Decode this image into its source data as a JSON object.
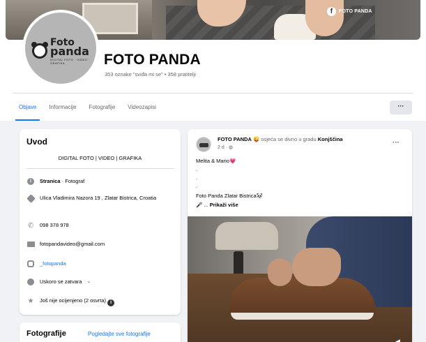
{
  "cover": {
    "badge_text": "FOTO PANDA"
  },
  "logo": {
    "line1": "Foto",
    "line2": "panda",
    "line3": "DIGITAL FOTO · VIDEO · GRAFIKA"
  },
  "page": {
    "title": "FOTO PANDA",
    "stats": "353 oznake \"sviđa mi se\" • 358 pratitelji"
  },
  "tabs": [
    {
      "label": "Objave",
      "active": true
    },
    {
      "label": "Informacije"
    },
    {
      "label": "Fotografije"
    },
    {
      "label": "Videozapisi"
    }
  ],
  "more_button": "···",
  "intro": {
    "heading": "Uvod",
    "bio": "DIGITAL FOTO | VIDEO | GRAFIKA",
    "category_strong": "Stranica",
    "category_rest": " · Fotograf",
    "address": "Ulica Vladimira Nazora 19 , Zlatar Bistrica, Croatia",
    "phone": "098 378 978",
    "email": "fotopandavideo@gmail.com",
    "instagram": "_fotopanda",
    "hours": "Uskoro se zatvara",
    "rating": "Još nije ocijenjeno (2 osvrta)"
  },
  "photos": {
    "heading": "Fotografije",
    "see_all": "Pogledajte sve fotografije"
  },
  "post": {
    "author": "FOTO PANDA",
    "emoji": "😜",
    "activity": " osjeća se divno u gradu ",
    "place": "Konjščina",
    "time": "2 d · ◍",
    "line1": "Melita & Mario",
    "heart": "💗",
    "dot1": ".",
    "dot2": ".",
    "dot3": ".",
    "line2": "Foto Panda Zlatar Bistrica🐼",
    "readmore_prefix": "🎤 ... ",
    "readmore": "Prikaži više",
    "dots": "···"
  },
  "colors": {
    "accent": "#1877f2",
    "background": "#f0f2f5",
    "muted": "#65676b"
  },
  "icons": [
    "facebook-icon",
    "info-icon",
    "location-icon",
    "phone-icon",
    "mail-icon",
    "instagram-icon",
    "clock-icon",
    "star-icon",
    "globe-icon",
    "more-icon",
    "sound-icon"
  ]
}
